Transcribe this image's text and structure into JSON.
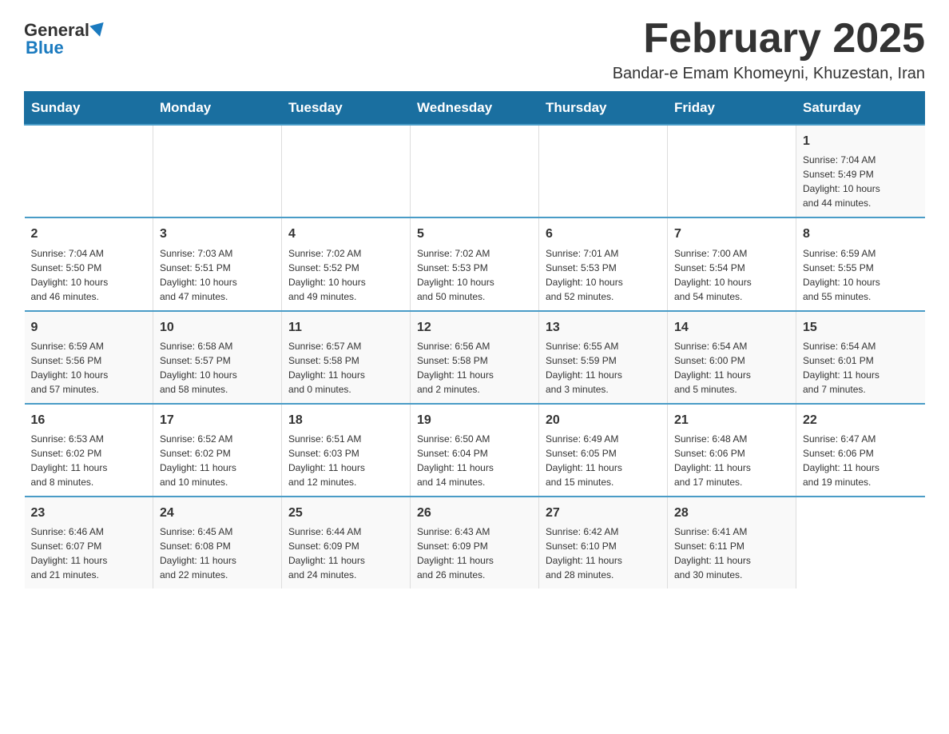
{
  "header": {
    "logo_general": "General",
    "logo_blue": "Blue",
    "month_title": "February 2025",
    "location": "Bandar-e Emam Khomeyni, Khuzestan, Iran"
  },
  "days_of_week": [
    "Sunday",
    "Monday",
    "Tuesday",
    "Wednesday",
    "Thursday",
    "Friday",
    "Saturday"
  ],
  "weeks": [
    [
      {
        "day": "",
        "info": ""
      },
      {
        "day": "",
        "info": ""
      },
      {
        "day": "",
        "info": ""
      },
      {
        "day": "",
        "info": ""
      },
      {
        "day": "",
        "info": ""
      },
      {
        "day": "",
        "info": ""
      },
      {
        "day": "1",
        "info": "Sunrise: 7:04 AM\nSunset: 5:49 PM\nDaylight: 10 hours\nand 44 minutes."
      }
    ],
    [
      {
        "day": "2",
        "info": "Sunrise: 7:04 AM\nSunset: 5:50 PM\nDaylight: 10 hours\nand 46 minutes."
      },
      {
        "day": "3",
        "info": "Sunrise: 7:03 AM\nSunset: 5:51 PM\nDaylight: 10 hours\nand 47 minutes."
      },
      {
        "day": "4",
        "info": "Sunrise: 7:02 AM\nSunset: 5:52 PM\nDaylight: 10 hours\nand 49 minutes."
      },
      {
        "day": "5",
        "info": "Sunrise: 7:02 AM\nSunset: 5:53 PM\nDaylight: 10 hours\nand 50 minutes."
      },
      {
        "day": "6",
        "info": "Sunrise: 7:01 AM\nSunset: 5:53 PM\nDaylight: 10 hours\nand 52 minutes."
      },
      {
        "day": "7",
        "info": "Sunrise: 7:00 AM\nSunset: 5:54 PM\nDaylight: 10 hours\nand 54 minutes."
      },
      {
        "day": "8",
        "info": "Sunrise: 6:59 AM\nSunset: 5:55 PM\nDaylight: 10 hours\nand 55 minutes."
      }
    ],
    [
      {
        "day": "9",
        "info": "Sunrise: 6:59 AM\nSunset: 5:56 PM\nDaylight: 10 hours\nand 57 minutes."
      },
      {
        "day": "10",
        "info": "Sunrise: 6:58 AM\nSunset: 5:57 PM\nDaylight: 10 hours\nand 58 minutes."
      },
      {
        "day": "11",
        "info": "Sunrise: 6:57 AM\nSunset: 5:58 PM\nDaylight: 11 hours\nand 0 minutes."
      },
      {
        "day": "12",
        "info": "Sunrise: 6:56 AM\nSunset: 5:58 PM\nDaylight: 11 hours\nand 2 minutes."
      },
      {
        "day": "13",
        "info": "Sunrise: 6:55 AM\nSunset: 5:59 PM\nDaylight: 11 hours\nand 3 minutes."
      },
      {
        "day": "14",
        "info": "Sunrise: 6:54 AM\nSunset: 6:00 PM\nDaylight: 11 hours\nand 5 minutes."
      },
      {
        "day": "15",
        "info": "Sunrise: 6:54 AM\nSunset: 6:01 PM\nDaylight: 11 hours\nand 7 minutes."
      }
    ],
    [
      {
        "day": "16",
        "info": "Sunrise: 6:53 AM\nSunset: 6:02 PM\nDaylight: 11 hours\nand 8 minutes."
      },
      {
        "day": "17",
        "info": "Sunrise: 6:52 AM\nSunset: 6:02 PM\nDaylight: 11 hours\nand 10 minutes."
      },
      {
        "day": "18",
        "info": "Sunrise: 6:51 AM\nSunset: 6:03 PM\nDaylight: 11 hours\nand 12 minutes."
      },
      {
        "day": "19",
        "info": "Sunrise: 6:50 AM\nSunset: 6:04 PM\nDaylight: 11 hours\nand 14 minutes."
      },
      {
        "day": "20",
        "info": "Sunrise: 6:49 AM\nSunset: 6:05 PM\nDaylight: 11 hours\nand 15 minutes."
      },
      {
        "day": "21",
        "info": "Sunrise: 6:48 AM\nSunset: 6:06 PM\nDaylight: 11 hours\nand 17 minutes."
      },
      {
        "day": "22",
        "info": "Sunrise: 6:47 AM\nSunset: 6:06 PM\nDaylight: 11 hours\nand 19 minutes."
      }
    ],
    [
      {
        "day": "23",
        "info": "Sunrise: 6:46 AM\nSunset: 6:07 PM\nDaylight: 11 hours\nand 21 minutes."
      },
      {
        "day": "24",
        "info": "Sunrise: 6:45 AM\nSunset: 6:08 PM\nDaylight: 11 hours\nand 22 minutes."
      },
      {
        "day": "25",
        "info": "Sunrise: 6:44 AM\nSunset: 6:09 PM\nDaylight: 11 hours\nand 24 minutes."
      },
      {
        "day": "26",
        "info": "Sunrise: 6:43 AM\nSunset: 6:09 PM\nDaylight: 11 hours\nand 26 minutes."
      },
      {
        "day": "27",
        "info": "Sunrise: 6:42 AM\nSunset: 6:10 PM\nDaylight: 11 hours\nand 28 minutes."
      },
      {
        "day": "28",
        "info": "Sunrise: 6:41 AM\nSunset: 6:11 PM\nDaylight: 11 hours\nand 30 minutes."
      },
      {
        "day": "",
        "info": ""
      }
    ]
  ]
}
